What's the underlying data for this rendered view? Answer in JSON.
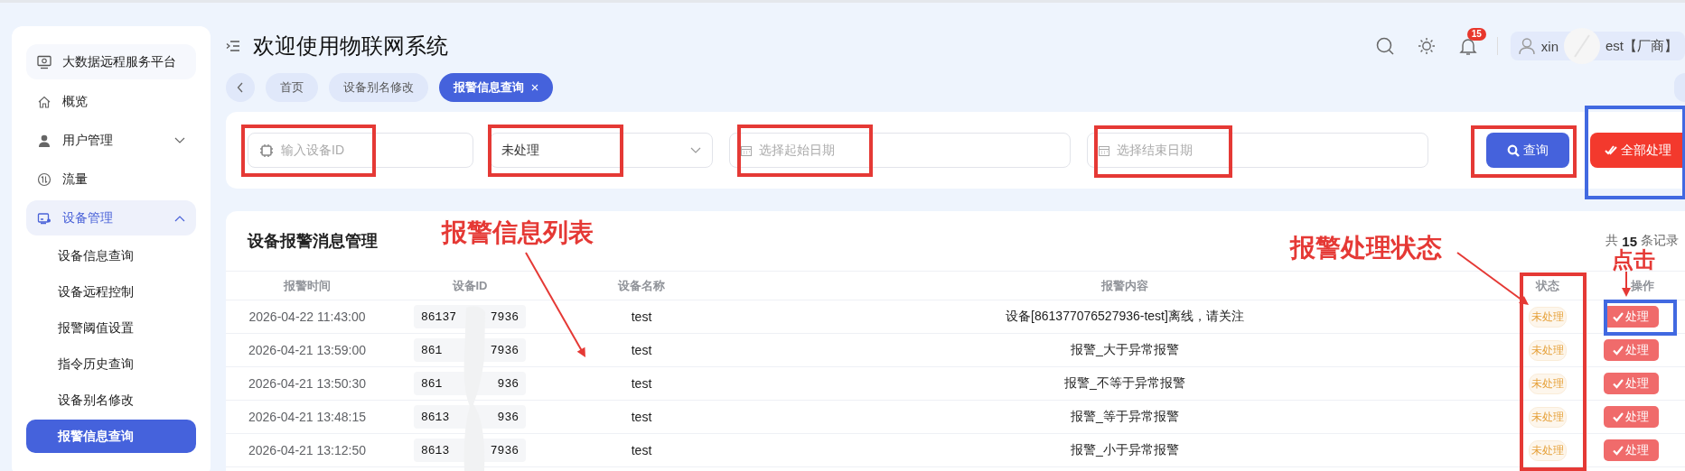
{
  "sidebar": {
    "brand": "大数据远程服务平台",
    "items": [
      {
        "label": "概览",
        "kind": "link"
      },
      {
        "label": "用户管理",
        "kind": "group",
        "expanded": false
      },
      {
        "label": "流量",
        "kind": "link"
      },
      {
        "label": "设备管理",
        "kind": "group",
        "expanded": true,
        "children": [
          {
            "label": "设备信息查询",
            "selected": false
          },
          {
            "label": "设备远程控制",
            "selected": false
          },
          {
            "label": "报警阈值设置",
            "selected": false
          },
          {
            "label": "指令历史查询",
            "selected": false
          },
          {
            "label": "设备别名修改",
            "selected": false
          },
          {
            "label": "报警信息查询",
            "selected": true
          }
        ]
      }
    ]
  },
  "header": {
    "title": "欢迎使用物联网系统",
    "notification_count": "15",
    "user": {
      "name_start": "xin",
      "name_end": "est【厂商】"
    }
  },
  "tabs": [
    {
      "label": "首页",
      "selected": false,
      "closable": false
    },
    {
      "label": "设备别名修改",
      "selected": false,
      "closable": false
    },
    {
      "label": "报警信息查询",
      "selected": true,
      "closable": true
    }
  ],
  "filters": {
    "device_id": {
      "placeholder": "输入设备ID"
    },
    "status": {
      "value": "未处理"
    },
    "start_date": {
      "placeholder": "选择起始日期"
    },
    "end_date": {
      "placeholder": "选择结束日期"
    },
    "search_button": "查询",
    "process_all_button": "全部处理"
  },
  "table": {
    "title": "设备报警消息管理",
    "total": {
      "prefix": "共",
      "count": "15",
      "suffix": "条记录"
    },
    "columns": [
      "报警时间",
      "设备ID",
      "设备名称",
      "报警内容",
      "状态",
      "操作"
    ],
    "rows": [
      {
        "time": "2026-04-22 11:43:00",
        "device_id_start": "86137",
        "device_id_end": "7936",
        "name": "test",
        "content": "设备[861377076527936-test]离线，请关注",
        "status": "未处理",
        "action": "处理"
      },
      {
        "time": "2026-04-21 13:59:00",
        "device_id_start": "861",
        "device_id_end": "7936",
        "name": "test",
        "content": "报警_大于异常报警",
        "status": "未处理",
        "action": "处理"
      },
      {
        "time": "2026-04-21 13:50:30",
        "device_id_start": "861",
        "device_id_end": "936",
        "name": "test",
        "content": "报警_不等于异常报警",
        "status": "未处理",
        "action": "处理"
      },
      {
        "time": "2026-04-21 13:48:15",
        "device_id_start": "8613",
        "device_id_end": "936",
        "name": "test",
        "content": "报警_等于异常报警",
        "status": "未处理",
        "action": "处理"
      },
      {
        "time": "2026-04-21 13:12:50",
        "device_id_start": "8613",
        "device_id_end": "7936",
        "name": "test",
        "content": "报警_小于异常报警",
        "status": "未处理",
        "action": "处理"
      }
    ]
  },
  "annotations": {
    "labels": [
      "报警信息列表",
      "报警处理状态",
      "点击"
    ],
    "boxes": [
      {
        "color": "#e53935"
      },
      {
        "color": "#e53935"
      },
      {
        "color": "#e53935"
      },
      {
        "color": "#e53935"
      },
      {
        "color": "#e53935"
      },
      {
        "color": "#4169e1"
      },
      {
        "color": "#e53935"
      },
      {
        "color": "#4169e1"
      }
    ]
  }
}
